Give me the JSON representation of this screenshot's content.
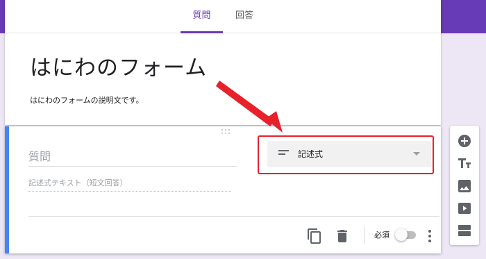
{
  "header": {
    "tabs": [
      {
        "label": "質問",
        "active": true
      },
      {
        "label": "回答",
        "active": false
      }
    ]
  },
  "form": {
    "title": "はにわのフォーム",
    "description": "はにわのフォームの説明文です。"
  },
  "question": {
    "title_placeholder": "質問",
    "answer_placeholder": "記述式テキスト（短文回答）",
    "type_label": "記述式",
    "footer": {
      "required_label": "必須",
      "required_on": false
    }
  },
  "side_toolbar": {
    "icons": [
      "add-question-icon",
      "add-title-icon",
      "add-image-icon",
      "add-video-icon",
      "add-section-icon"
    ]
  },
  "colors": {
    "accent": "#673ab7",
    "card_accent": "#4285f4",
    "highlight": "#e8202a"
  }
}
